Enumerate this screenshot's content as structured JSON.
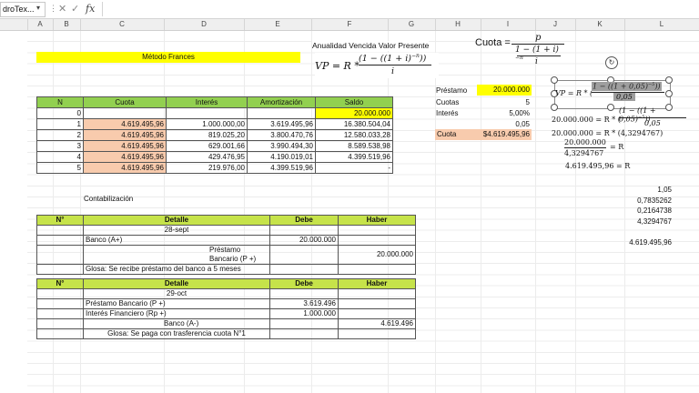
{
  "formula_bar": {
    "name_box": "droTex...",
    "fx": "fx"
  },
  "columns": [
    "A",
    "B",
    "C",
    "D",
    "E",
    "F",
    "G",
    "H",
    "I",
    "J",
    "K",
    "L"
  ],
  "method_title": "Método Frances",
  "annuity_title": "Anualidad Vencida Valor Presente",
  "vp_formula": {
    "lhs": "VP = R *",
    "num": "(1 − ((1 + i)",
    "exp": "−n",
    "num_close": "))",
    "den": "i"
  },
  "cuota_formula": {
    "lhs": "Cuota =",
    "num": "p",
    "den_top": "1 − (1 + i)",
    "den_exp": "−n",
    "den_bottom": "i"
  },
  "amort_table": {
    "headers": [
      "N",
      "Cuota",
      "Interés",
      "Amortización",
      "Saldo"
    ],
    "rows": [
      [
        "0",
        "",
        "",
        "",
        "20.000.000"
      ],
      [
        "1",
        "4.619.495,96",
        "1.000.000,00",
        "3.619.495,96",
        "16.380.504,04"
      ],
      [
        "2",
        "4.619.495,96",
        "819.025,20",
        "3.800.470,76",
        "12.580.033,28"
      ],
      [
        "3",
        "4.619.495,96",
        "629.001,66",
        "3.990.494,30",
        "8.589.538,98"
      ],
      [
        "4",
        "4.619.495,96",
        "429.476,95",
        "4.190.019,01",
        "4.399.519,96"
      ],
      [
        "5",
        "4.619.495,96",
        "219.976,00",
        "4.399.519,96",
        "-"
      ]
    ]
  },
  "params": [
    {
      "label": "Préstamo",
      "value": "20.000.000"
    },
    {
      "label": "Cuotas",
      "value": "5"
    },
    {
      "label": "Interés",
      "value": "5,00%"
    },
    {
      "label": "",
      "value": "0,05"
    },
    {
      "label": "Cuota",
      "value": "$4.619.495,96"
    }
  ],
  "derivation": {
    "eq1_lhs": "VP = R * (",
    "eq1_num": "1 − ((1 + 0,05)",
    "eq1_exp": "−5",
    "eq1_close": "))",
    "eq1_den": "0,05",
    "eq2_lhs": "20.000.000 = R * (",
    "eq2_num": "(1 − ((1 + 0,05)",
    "eq2_exp": "−5",
    "eq2_close": "))",
    "eq2_den": "0,05",
    "eq3": "20.000.000 = R * (4,3294767)",
    "eq4_num": "20.000.000",
    "eq4_den": "4,3294767",
    "eq4_rhs": "= R",
    "eq5": "4.619.495,96 = R"
  },
  "side_values": [
    "1,05",
    "0,7835262",
    "0,2164738",
    "4,3294767",
    "4.619.495,96"
  ],
  "contab_label": "Contabilización",
  "journal_headers": [
    "N°",
    "Detalle",
    "Debe",
    "Haber"
  ],
  "journal1": {
    "date": "28-sept",
    "debit_account": "Banco (A+)",
    "debit_value": "20.000.000",
    "credit_account": "Préstamo Bancario (P +)",
    "credit_value": "20.000.000",
    "glosa": "Glosa: Se recibe préstamo del banco a 5 meses"
  },
  "journal2": {
    "date": "29-oct",
    "debit1_account": "Préstamo Bancario (P +)",
    "debit1_value": "3.619.496",
    "debit2_account": "Interés Financiero (Rp +)",
    "debit2_value": "1.000.000",
    "credit_account": "Banco (A-)",
    "credit_value": "4.619.496",
    "glosa": "Glosa: Se paga con trasferencia cuota N°1"
  }
}
